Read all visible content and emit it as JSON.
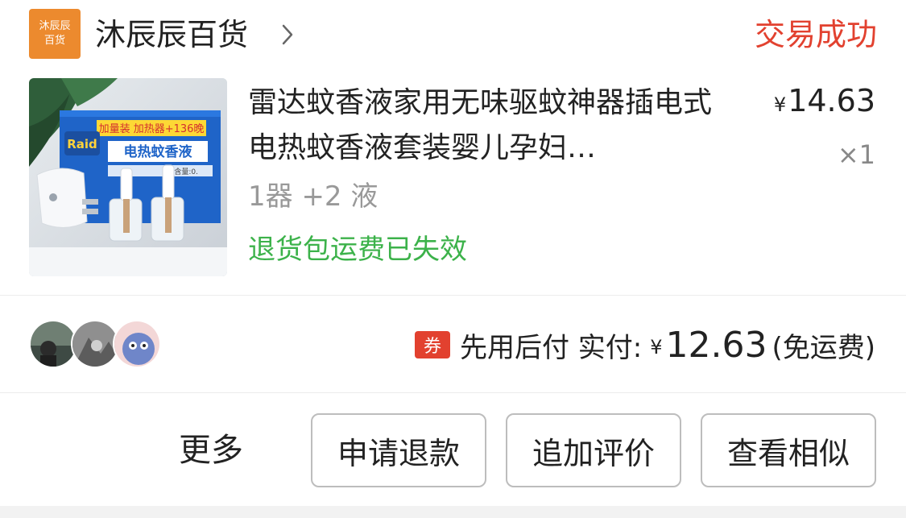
{
  "store": {
    "logo_line1": "沐辰辰",
    "logo_line2": "百货",
    "name": "沐辰辰百货",
    "logo_color": "#ec8a2e"
  },
  "order": {
    "status": "交易成功",
    "status_color": "#e2412f"
  },
  "product": {
    "title": "雷达蚊香液家用无味驱蚊神器插电式电热蚊香液套装婴儿孕妇…",
    "price_currency": "¥",
    "price": "14.63",
    "quantity": "×1",
    "sku": "1器 +2 液",
    "return_note": "退货包运费已失效",
    "return_note_color": "#3cb24a",
    "image": {
      "box_text_1": "加量装 加热器+136晚",
      "box_text_2": "电热蚊香液",
      "brand": "Raid",
      "box_text_3": "总含量:0."
    }
  },
  "payment": {
    "coupon_badge": "券",
    "label": "先用后付 实付:",
    "currency": "¥",
    "amount": "12.63",
    "shipping": "(免运费)"
  },
  "actions": {
    "more": "更多",
    "refund": "申请退款",
    "add_review": "追加评价",
    "similar": "查看相似"
  }
}
